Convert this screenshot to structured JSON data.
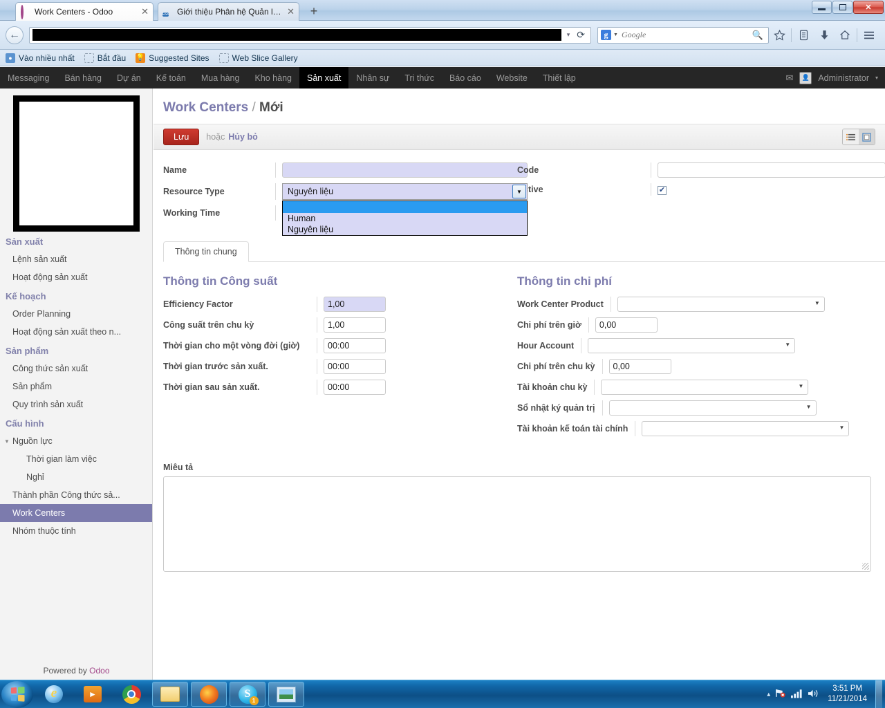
{
  "window": {
    "tabs": [
      {
        "title": "Work Centers - Odoo",
        "icon": "odoo-favicon",
        "active": true
      },
      {
        "title": "Giới thiệu Phân hệ Quản lý...",
        "icon": "esx-favicon",
        "active": false
      }
    ],
    "new_tab_label": "+",
    "close_label": "✕",
    "controls": {
      "minimize": "minimize-icon",
      "restore": "restore-icon",
      "close": "✕"
    }
  },
  "browser": {
    "back_label": "←",
    "url_value": "",
    "url_dropdown": "▾",
    "reload": "⟳",
    "search": {
      "engine": "Google",
      "placeholder": "Google",
      "magnifier": "⚲"
    },
    "toolbar_icons": [
      "bookmark-star-icon",
      "reader-list-icon",
      "downloads-icon",
      "home-icon",
      "menu-hamburger-icon"
    ],
    "bookmarks": [
      {
        "label": "Vào nhiều nhất",
        "icon": "most-visited-icon"
      },
      {
        "label": "Bắt đầu",
        "icon": "getting-started-icon"
      },
      {
        "label": "Suggested Sites",
        "icon": "suggested-sites-icon"
      },
      {
        "label": "Web Slice Gallery",
        "icon": "web-slice-icon"
      }
    ]
  },
  "odoo_menu": {
    "items": [
      {
        "label": "Messaging",
        "active": false
      },
      {
        "label": "Bán hàng",
        "active": false
      },
      {
        "label": "Dự án",
        "active": false
      },
      {
        "label": "Kế toán",
        "active": false
      },
      {
        "label": "Mua hàng",
        "active": false
      },
      {
        "label": "Kho hàng",
        "active": false
      },
      {
        "label": "Sản xuất",
        "active": true
      },
      {
        "label": "Nhân sự",
        "active": false
      },
      {
        "label": "Tri thức",
        "active": false
      },
      {
        "label": "Báo cáo",
        "active": false
      },
      {
        "label": "Website",
        "active": false
      },
      {
        "label": "Thiết lập",
        "active": false
      }
    ],
    "user": "Administrator",
    "user_caret": "▾",
    "mail_icon": "✉"
  },
  "sidebar": {
    "groups": [
      {
        "title": "Sản xuất",
        "items": [
          {
            "label": "Lệnh sản xuất",
            "level": 1,
            "selected": false
          },
          {
            "label": "Hoạt động sản xuất",
            "level": 1,
            "selected": false
          }
        ]
      },
      {
        "title": "Kế hoạch",
        "items": [
          {
            "label": "Order Planning",
            "level": 1,
            "selected": false
          },
          {
            "label": "Hoạt động sản xuất theo n...",
            "level": 1,
            "selected": false
          }
        ]
      },
      {
        "title": "Sản phẩm",
        "items": [
          {
            "label": "Công thức sản xuất",
            "level": 1,
            "selected": false
          },
          {
            "label": "Sản phẩm",
            "level": 1,
            "selected": false
          },
          {
            "label": "Quy trình sản xuất",
            "level": 1,
            "selected": false
          }
        ]
      },
      {
        "title": "Cấu hình",
        "items": [
          {
            "label": "Nguồn lực",
            "level": 1,
            "selected": false,
            "expandable": true,
            "expanded": true
          },
          {
            "label": "Thời gian làm việc",
            "level": 2,
            "selected": false
          },
          {
            "label": "Nghỉ",
            "level": 2,
            "selected": false
          },
          {
            "label": "Thành phần Công thức sả...",
            "level": 1,
            "selected": false
          },
          {
            "label": "Work Centers",
            "level": 1,
            "selected": true
          },
          {
            "label": "Nhóm thuộc tính",
            "level": 1,
            "selected": false
          }
        ]
      }
    ],
    "footer_prefix": "Powered by ",
    "footer_brand": "Odoo"
  },
  "form": {
    "breadcrumb_root": "Work Centers",
    "breadcrumb_sep": " / ",
    "breadcrumb_current": "Mới",
    "save_label": "Lưu",
    "or_label": "hoặc",
    "cancel_label": "Hủy bỏ",
    "view_list_icon": "list-view-icon",
    "view_form_icon": "form-view-icon",
    "top_left": [
      {
        "label": "Name",
        "type": "text",
        "value": "",
        "focused": true
      },
      {
        "label": "Resource Type",
        "type": "select",
        "value": "Nguyên liệu"
      },
      {
        "label": "Working Time",
        "type": "none",
        "value": ""
      }
    ],
    "resource_type_options": [
      "",
      "Human",
      "Nguyên liệu"
    ],
    "resource_type_highlighted_index": 0,
    "top_right": [
      {
        "label": "Code",
        "type": "text",
        "value": ""
      },
      {
        "label": "Active",
        "type": "checkbox",
        "checked": true,
        "check_glyph": "✔"
      }
    ],
    "tabs": [
      {
        "label": "Thông tin chung",
        "active": true
      }
    ],
    "group_capacity_title": "Thông tin Công suất",
    "capacity_fields": [
      {
        "label": "Efficiency Factor",
        "value": "1,00",
        "focused": true
      },
      {
        "label": "Công suất trên chu kỳ",
        "value": "1,00",
        "focused": false
      },
      {
        "label": "Thời gian cho một vòng đời (giờ)",
        "value": "00:00",
        "focused": false
      },
      {
        "label": "Thời gian trước sản xuất.",
        "value": "00:00",
        "focused": false
      },
      {
        "label": "Thời gian sau sản xuất.",
        "value": "00:00",
        "focused": false
      }
    ],
    "group_cost_title": "Thông tin chi phí",
    "cost_fields": [
      {
        "label": "Work Center Product",
        "type": "dropdown",
        "value": ""
      },
      {
        "label": "Chi phí trên giờ",
        "type": "text",
        "value": "0,00"
      },
      {
        "label": "Hour Account",
        "type": "dropdown",
        "value": ""
      },
      {
        "label": "Chi phí trên chu kỳ",
        "type": "text",
        "value": "0,00"
      },
      {
        "label": "Tài khoản chu kỳ",
        "type": "dropdown",
        "value": ""
      },
      {
        "label": "Sổ nhật ký quản trị",
        "type": "dropdown",
        "value": ""
      },
      {
        "label": "Tài khoản kế toán tài chính",
        "type": "dropdown",
        "value": ""
      }
    ],
    "description_label": "Miêu tả",
    "description_value": ""
  },
  "taskbar": {
    "start_label": "start-orb",
    "apps": [
      {
        "name": "internet-explorer",
        "pinned": false
      },
      {
        "name": "windows-media-player",
        "pinned": false
      },
      {
        "name": "google-chrome",
        "pinned": false
      },
      {
        "name": "file-explorer",
        "pinned": true
      },
      {
        "name": "mozilla-firefox",
        "pinned": true
      },
      {
        "name": "skype",
        "pinned": true,
        "badge": "1"
      },
      {
        "name": "photo-viewer",
        "pinned": true
      }
    ],
    "tray": {
      "expand": "▴",
      "network_icon": "network-error-icon",
      "signal_icon": "signal-bars-icon",
      "volume_icon": "🔊"
    },
    "time": "3:51 PM",
    "date": "11/21/2014"
  },
  "colors": {
    "odoo_purple": "#7c7bad",
    "save_red": "#a7251c",
    "menu_black": "#262626",
    "focus_field": "#d8d8f5",
    "dropdown_highlight": "#2a9bf0"
  }
}
